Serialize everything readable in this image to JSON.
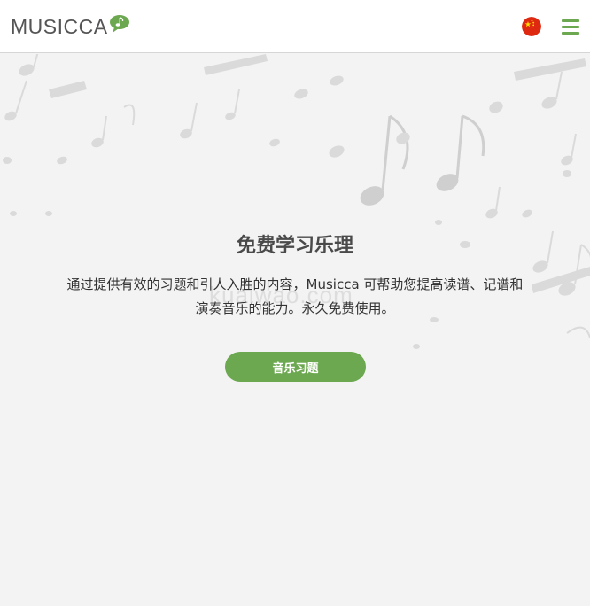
{
  "header": {
    "logo_text": "MUSICCA",
    "flag_icon": "china-flag-icon",
    "menu_icon": "hamburger-menu-icon",
    "brand_color": "#6ba84f"
  },
  "hero": {
    "title": "免费学习乐理",
    "description": "通过提供有效的习题和引人入胜的内容，Musicca 可帮助您提高读谱、记谱和演奏音乐的能力。永久免费使用。",
    "watermark": "kuaiwao.com",
    "cta_label": "音乐习题"
  }
}
